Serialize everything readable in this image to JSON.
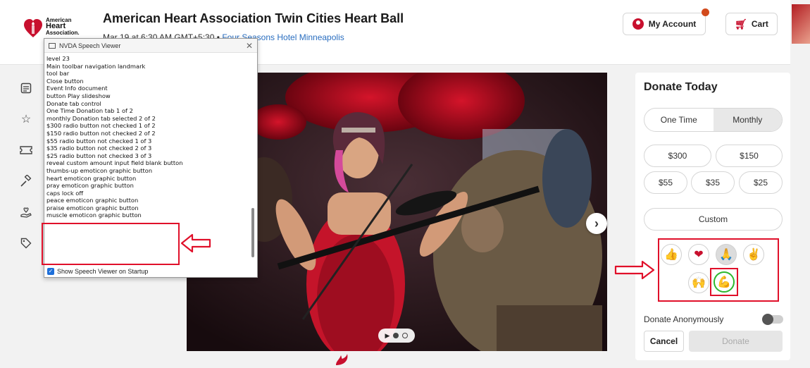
{
  "header": {
    "logo_lines": [
      "American",
      "Heart",
      "Association."
    ],
    "event_title": "American Heart Association Twin Cities Heart Ball",
    "event_datetime": "Mar 19 at 6:30 AM GMT+5:30",
    "separator": "•",
    "venue": "Four Seasons Hotel Minneapolis",
    "my_account_label": "My Account",
    "cart_label": "Cart"
  },
  "left_rail": {
    "icons": [
      "event-info-icon",
      "star-icon",
      "ticket-icon",
      "auction-gavel-icon",
      "donate-hand-heart-icon",
      "tag-icon"
    ]
  },
  "nvda": {
    "window_title": "NVDA Speech Viewer",
    "lines": [
      "level 23",
      "Main toolbar  navigation landmark",
      "tool bar",
      "Close  button",
      "Event Info  document",
      "button   Play slideshow",
      "Donate  tab control",
      "One Time Donation  tab  1 of 2",
      "monthly Donation  tab  selected  2 of 2",
      "$300  radio button  not checked  1 of 2",
      "$150  radio button  not checked  2 of 2",
      "$55  radio button  not checked  1 of 3",
      "$35  radio button  not checked  2 of 3",
      "$25  radio button  not checked  3 of 3",
      "reveal custom amount input field blank  button",
      "thumbs-up emoticon  graphic   button",
      "heart emoticon  graphic   button",
      "pray emoticon  graphic   button",
      "caps lock off",
      "peace emoticon  graphic   button",
      "praise emoticon  graphic   button",
      "muscle emoticon  graphic   button"
    ],
    "show_on_startup_label": "Show Speech Viewer on Startup",
    "show_on_startup_checked": true
  },
  "carousel": {
    "next_glyph": "›",
    "play_glyph": "▶"
  },
  "donate": {
    "title": "Donate Today",
    "tabs": [
      {
        "label": "One Time",
        "selected": false
      },
      {
        "label": "Monthly",
        "selected": true
      }
    ],
    "amounts_row1": [
      "$300",
      "$150"
    ],
    "amounts_row2": [
      "$55",
      "$35",
      "$25"
    ],
    "custom_label": "Custom",
    "emoticons": [
      {
        "name": "thumbs-up",
        "glyph": "👍"
      },
      {
        "name": "heart",
        "glyph": "❤"
      },
      {
        "name": "pray",
        "glyph": "🙏"
      },
      {
        "name": "peace",
        "glyph": "✌"
      },
      {
        "name": "praise",
        "glyph": "🙌"
      },
      {
        "name": "muscle",
        "glyph": "💪"
      }
    ],
    "anonymous_label": "Donate Anonymously",
    "cancel_label": "Cancel",
    "donate_label": "Donate"
  },
  "colors": {
    "brand_red": "#c8102e",
    "annotation_red": "#e0102a"
  }
}
